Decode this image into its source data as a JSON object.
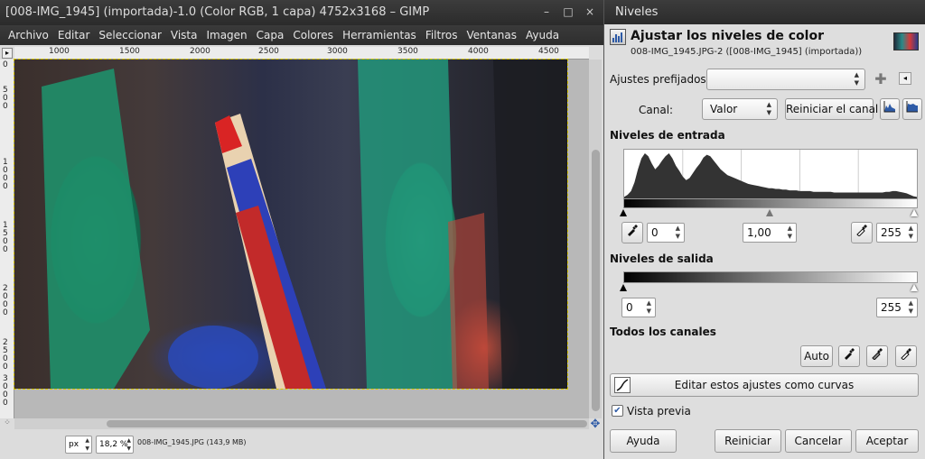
{
  "gimp": {
    "title": "[008-IMG_1945] (importada)-1.0 (Color RGB, 1 capa) 4752x3168 – GIMP",
    "window_buttons": {
      "minimize": "–",
      "maximize": "□",
      "close": "×"
    },
    "menu": [
      "Archivo",
      "Editar",
      "Seleccionar",
      "Vista",
      "Imagen",
      "Capa",
      "Colores",
      "Herramientas",
      "Filtros",
      "Ventanas",
      "Ayuda"
    ],
    "hruler_ticks": [
      "1000",
      "1500",
      "2000",
      "2500",
      "3000",
      "3500",
      "4000",
      "4500"
    ],
    "vruler_ticks": [
      "0",
      "5 0 0",
      "1 0 0 0",
      "1 5 0 0",
      "2 0 0 0",
      "2 5 0 0",
      "3 0 0 0"
    ],
    "status": {
      "unit": "px",
      "zoom": "18,2 %",
      "text": "008-IMG_1945.JPG (143,9 MB)"
    }
  },
  "levels": {
    "window_title": "Niveles",
    "header_title": "Ajustar los niveles de color",
    "header_subtitle": "008-IMG_1945.JPG-2 ([008-IMG_1945] (importada))",
    "presets_label": "Ajustes prefijados:",
    "presets_value": "",
    "channel_label": "Canal:",
    "channel_value": "Valor",
    "reset_channel_button": "Reiniciar el canal",
    "input_section": "Niveles de entrada",
    "input_low": "0",
    "input_gamma": "1,00",
    "input_high": "255",
    "output_section": "Niveles de salida",
    "output_low": "0",
    "output_high": "255",
    "all_channels_section": "Todos los canales",
    "auto_button": "Auto",
    "edit_curves_button": "Editar estos ajustes como curvas",
    "preview_label": "Vista previa",
    "preview_checked": true,
    "help_button": "Ayuda",
    "reset_button": "Reiniciar",
    "cancel_button": "Cancelar",
    "ok_button": "Aceptar",
    "histogram": [
      2,
      5,
      10,
      22,
      40,
      55,
      62,
      58,
      48,
      40,
      45,
      52,
      58,
      62,
      55,
      45,
      38,
      30,
      25,
      28,
      35,
      42,
      48,
      56,
      60,
      58,
      52,
      46,
      40,
      36,
      32,
      30,
      28,
      26,
      24,
      22,
      20,
      19,
      18,
      17,
      16,
      15,
      14,
      14,
      13,
      13,
      12,
      12,
      11,
      11,
      11,
      10,
      10,
      10,
      10,
      9,
      9,
      9,
      9,
      9,
      9,
      8,
      8,
      8,
      8,
      8,
      8,
      8,
      8,
      8,
      8,
      8,
      8,
      8,
      8,
      8,
      9,
      9,
      10,
      10,
      9,
      8,
      7,
      5,
      3,
      2
    ]
  }
}
